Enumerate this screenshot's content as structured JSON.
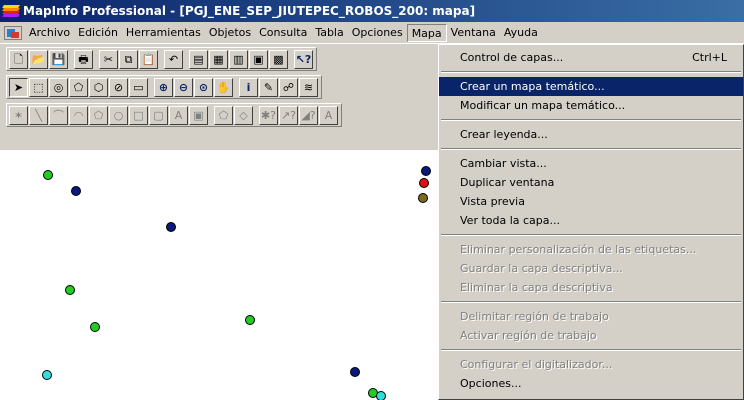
{
  "window": {
    "title": "MapInfo Professional - [PGJ_ENE_SEP_JIUTEPEC_ROBOS_200: mapa]",
    "app_icon": "mapinfo-logo-icon"
  },
  "menubar": {
    "items": [
      "Archivo",
      "Edición",
      "Herramientas",
      "Objetos",
      "Consulta",
      "Tabla",
      "Opciones",
      "Mapa",
      "Ventana",
      "Ayuda"
    ],
    "open_menu": "Mapa"
  },
  "toolbars": {
    "standard": [
      {
        "icon": "new-icon",
        "glyph": "🗋"
      },
      {
        "icon": "open-icon",
        "glyph": "📂"
      },
      {
        "icon": "save-icon",
        "glyph": "💾"
      },
      {
        "icon": "print-icon",
        "glyph": "🖶"
      },
      {
        "icon": "cut-icon",
        "glyph": "✂"
      },
      {
        "icon": "copy-icon",
        "glyph": "⧉"
      },
      {
        "icon": "paste-icon",
        "glyph": "📋"
      },
      {
        "icon": "undo-icon",
        "glyph": "↶"
      },
      {
        "icon": "new-browser-icon",
        "glyph": "▤"
      },
      {
        "icon": "new-map-icon",
        "glyph": "▦"
      },
      {
        "icon": "new-graph-icon",
        "glyph": "▥"
      },
      {
        "icon": "new-layout-icon",
        "glyph": "▣"
      },
      {
        "icon": "redistrict-icon",
        "glyph": "▩"
      },
      {
        "icon": "help-pointer-icon",
        "glyph": "↖?"
      }
    ],
    "main": [
      {
        "icon": "select-arrow-icon",
        "glyph": "➤"
      },
      {
        "icon": "marquee-select-icon",
        "glyph": "⬚"
      },
      {
        "icon": "radius-select-icon",
        "glyph": "◎"
      },
      {
        "icon": "polygon-select-icon",
        "glyph": "⬠"
      },
      {
        "icon": "boundary-select-icon",
        "glyph": "⬡"
      },
      {
        "icon": "unselect-icon",
        "glyph": "⊘"
      },
      {
        "icon": "graph-select-icon",
        "glyph": "▭"
      },
      {
        "icon": "zoom-in-icon",
        "glyph": "⊕"
      },
      {
        "icon": "zoom-out-icon",
        "glyph": "⊖"
      },
      {
        "icon": "change-view-icon",
        "glyph": "⊙"
      },
      {
        "icon": "grabber-hand-icon",
        "glyph": "✋"
      },
      {
        "icon": "info-tool-icon",
        "glyph": "i"
      },
      {
        "icon": "label-tool-icon",
        "glyph": "✎"
      },
      {
        "icon": "drag-window-icon",
        "glyph": "☍"
      },
      {
        "icon": "layer-control-icon",
        "glyph": "≋"
      }
    ],
    "drawing": [
      {
        "icon": "symbol-tool-icon",
        "glyph": "✶"
      },
      {
        "icon": "line-tool-icon",
        "glyph": "╲"
      },
      {
        "icon": "polyline-tool-icon",
        "glyph": "⌒"
      },
      {
        "icon": "arc-tool-icon",
        "glyph": "◠"
      },
      {
        "icon": "polygon-tool-icon",
        "glyph": "⬠"
      },
      {
        "icon": "ellipse-tool-icon",
        "glyph": "○"
      },
      {
        "icon": "rectangle-tool-icon",
        "glyph": "□"
      },
      {
        "icon": "rounded-rectangle-tool-icon",
        "glyph": "▢"
      },
      {
        "icon": "text-tool-icon",
        "glyph": "A"
      },
      {
        "icon": "frame-tool-icon",
        "glyph": "▣"
      },
      {
        "icon": "reshape-icon",
        "glyph": "⬠"
      },
      {
        "icon": "add-node-icon",
        "glyph": "◇"
      },
      {
        "icon": "symbol-style-icon",
        "glyph": "✱?"
      },
      {
        "icon": "line-style-icon",
        "glyph": "↗?"
      },
      {
        "icon": "region-style-icon",
        "glyph": "◢?"
      },
      {
        "icon": "text-style-icon",
        "glyph": "A"
      }
    ]
  },
  "map_points": [
    {
      "color": "#22cc22"
    },
    {
      "color": "#0a1a7a"
    },
    {
      "color": "#0a1a7a"
    },
    {
      "color": "#22cc22"
    },
    {
      "color": "#22cc22"
    },
    {
      "color": "#22cc22"
    },
    {
      "color": "#33dddd"
    },
    {
      "color": "#0a1a7a"
    },
    {
      "color": "#22cc22"
    },
    {
      "color": "#33dddd"
    },
    {
      "color": "#0a1a7a"
    },
    {
      "color": "#dd1111"
    },
    {
      "color": "#7a6a1a"
    },
    {
      "color": "#33dddd"
    }
  ],
  "dropdown": {
    "items": [
      {
        "label": "Control de capas...",
        "shortcut": "Ctrl+L",
        "state": "normal"
      },
      {
        "sep": true
      },
      {
        "label": "Crear un mapa temático...",
        "shortcut": "",
        "state": "highlighted"
      },
      {
        "label": "Modificar un mapa temático...",
        "shortcut": "",
        "state": "normal"
      },
      {
        "sep": true
      },
      {
        "label": "Crear leyenda...",
        "shortcut": "",
        "state": "normal"
      },
      {
        "sep": true
      },
      {
        "label": "Cambiar vista...",
        "shortcut": "",
        "state": "normal"
      },
      {
        "label": "Duplicar ventana",
        "shortcut": "",
        "state": "normal"
      },
      {
        "label": "Vista previa",
        "shortcut": "",
        "state": "normal"
      },
      {
        "label": "Ver toda la capa...",
        "shortcut": "",
        "state": "normal"
      },
      {
        "sep": true
      },
      {
        "label": "Eliminar personalización de las etiquetas...",
        "shortcut": "",
        "state": "disabled"
      },
      {
        "label": "Guardar la capa descriptiva...",
        "shortcut": "",
        "state": "disabled"
      },
      {
        "label": "Eliminar la capa descriptiva",
        "shortcut": "",
        "state": "disabled"
      },
      {
        "sep": true
      },
      {
        "label": "Delimitar región de trabajo",
        "shortcut": "",
        "state": "disabled"
      },
      {
        "label": "Activar región de trabajo",
        "shortcut": "",
        "state": "disabled"
      },
      {
        "sep": true
      },
      {
        "label": "Configurar el digitalizador...",
        "shortcut": "",
        "state": "disabled"
      },
      {
        "label": "Opciones...",
        "shortcut": "",
        "state": "normal"
      }
    ]
  }
}
